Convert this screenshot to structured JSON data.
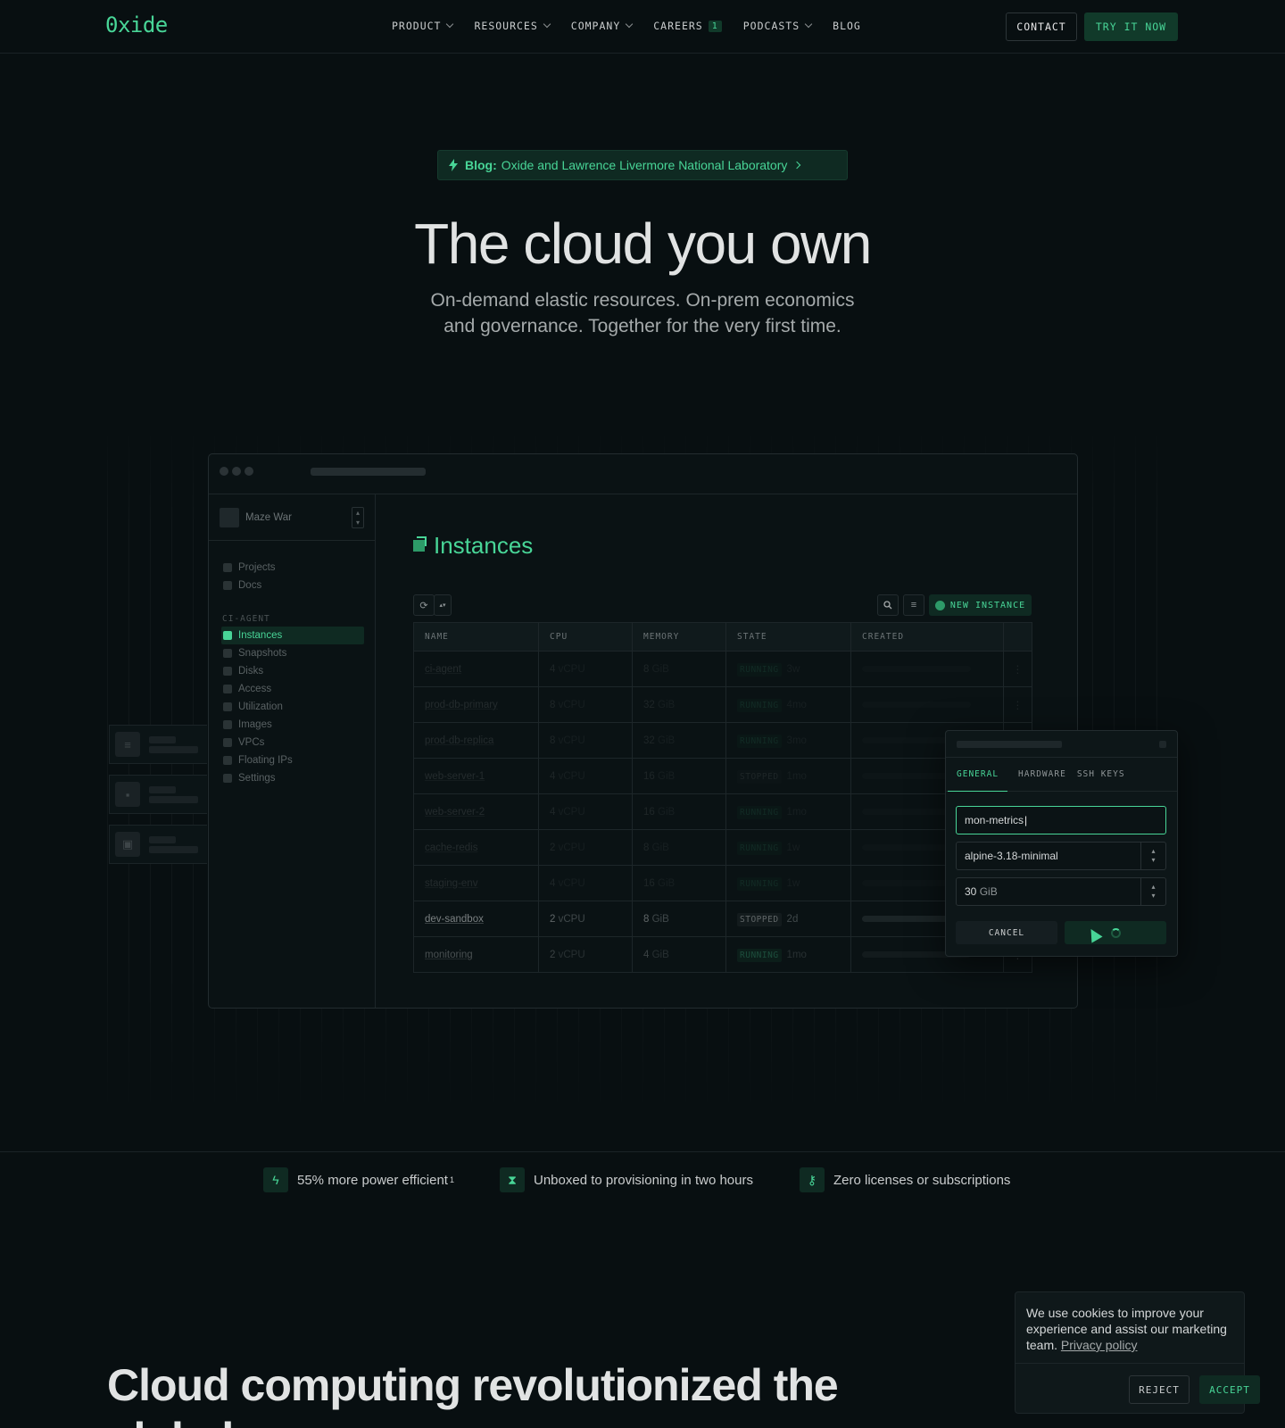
{
  "nav": {
    "logo": "0xide",
    "links": [
      {
        "label": "PRODUCT",
        "has_menu": true
      },
      {
        "label": "RESOURCES",
        "has_menu": true
      },
      {
        "label": "COMPANY",
        "has_menu": true
      },
      {
        "label": "CAREERS",
        "badge": "1"
      },
      {
        "label": "PODCASTS",
        "has_menu": true
      },
      {
        "label": "BLOG"
      }
    ],
    "contact_label": "CONTACT",
    "try_label": "TRY IT NOW"
  },
  "hero": {
    "blog_prefix": "Blog:",
    "blog_text": "Oxide and Lawrence Livermore National Laboratory",
    "title": "The cloud you own",
    "subtitle_line1": "On-demand elastic resources. On-prem economics",
    "subtitle_line2": "and governance. Together for the very first time."
  },
  "app": {
    "org_name": "Maze War",
    "sidebar_top": [
      {
        "label": "Projects",
        "icon": "folder-icon"
      },
      {
        "label": "Docs",
        "icon": "document-icon"
      }
    ],
    "section": "CI-AGENT",
    "sidebar_items": [
      {
        "label": "Instances",
        "icon": "instances-icon",
        "active": true
      },
      {
        "label": "Snapshots",
        "icon": "snapshot-icon"
      },
      {
        "label": "Disks",
        "icon": "disk-icon"
      },
      {
        "label": "Access",
        "icon": "access-icon"
      },
      {
        "label": "Utilization",
        "icon": "chart-icon"
      },
      {
        "label": "Images",
        "icon": "images-icon"
      },
      {
        "label": "VPCs",
        "icon": "network-icon"
      },
      {
        "label": "Floating IPs",
        "icon": "globe-icon"
      },
      {
        "label": "Settings",
        "icon": "gear-icon"
      }
    ],
    "page_title": "Instances",
    "new_instance_label": "NEW INSTANCE",
    "columns": [
      "NAME",
      "CPU",
      "MEMORY",
      "STATE",
      "CREATED"
    ],
    "rows": [
      {
        "name": "ci-agent",
        "cpu": "4",
        "cpu_unit": "vCPU",
        "mem": "8",
        "mem_unit": "GiB",
        "state": "RUNNING",
        "age": "3w"
      },
      {
        "name": "prod-db-primary",
        "cpu": "8",
        "cpu_unit": "vCPU",
        "mem": "32",
        "mem_unit": "GiB",
        "state": "RUNNING",
        "age": "4mo"
      },
      {
        "name": "prod-db-replica",
        "cpu": "8",
        "cpu_unit": "vCPU",
        "mem": "32",
        "mem_unit": "GiB",
        "state": "RUNNING",
        "age": "3mo"
      },
      {
        "name": "web-server-1",
        "cpu": "4",
        "cpu_unit": "vCPU",
        "mem": "16",
        "mem_unit": "GiB",
        "state": "STOPPED",
        "age": "1mo"
      },
      {
        "name": "web-server-2",
        "cpu": "4",
        "cpu_unit": "vCPU",
        "mem": "16",
        "mem_unit": "GiB",
        "state": "RUNNING",
        "age": "1mo"
      },
      {
        "name": "cache-redis",
        "cpu": "2",
        "cpu_unit": "vCPU",
        "mem": "8",
        "mem_unit": "GiB",
        "state": "RUNNING",
        "age": "1w"
      },
      {
        "name": "staging-env",
        "cpu": "4",
        "cpu_unit": "vCPU",
        "mem": "16",
        "mem_unit": "GiB",
        "state": "RUNNING",
        "age": "1w"
      },
      {
        "name": "dev-sandbox",
        "cpu": "2",
        "cpu_unit": "vCPU",
        "mem": "8",
        "mem_unit": "GiB",
        "state": "STOPPED",
        "age": "2d"
      },
      {
        "name": "monitoring",
        "cpu": "2",
        "cpu_unit": "vCPU",
        "mem": "4",
        "mem_unit": "GiB",
        "state": "RUNNING",
        "age": "1mo"
      }
    ],
    "form": {
      "tabs": [
        "GENERAL",
        "HARDWARE",
        "SSH KEYS"
      ],
      "name_value": "mon-metrics",
      "image_value": "alpine-3.18-minimal",
      "disk_value": "30",
      "disk_unit": "GiB",
      "cancel_label": "CANCEL"
    }
  },
  "features": [
    {
      "text": "55% more power efficient",
      "sup": "1",
      "icon": "bolt-icon"
    },
    {
      "text": "Unboxed to provisioning in two hours",
      "icon": "hourglass-icon"
    },
    {
      "text": "Zero licenses or subscriptions",
      "icon": "key-icon"
    }
  ],
  "section_title": "Cloud computing revolutionized the global economy",
  "cookie": {
    "text": "We use cookies to improve your experience and assist our marketing team.",
    "link": "Privacy policy",
    "reject": "REJECT",
    "accept": "ACCEPT"
  },
  "colors": {
    "accent": "#48d597",
    "bg": "#080f11",
    "accent_bg": "#0f2a22"
  }
}
